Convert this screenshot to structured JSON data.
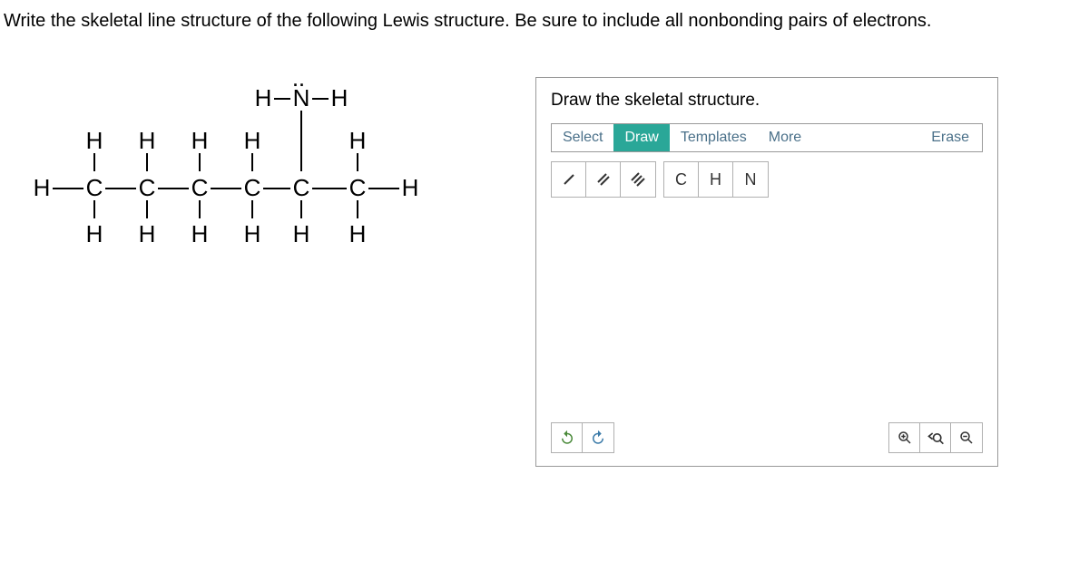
{
  "question": "Write the skeletal line structure of the following Lewis structure. Be sure to include all nonbonding pairs of electrons.",
  "draw_panel": {
    "title": "Draw the skeletal structure.",
    "tabs": {
      "select": "Select",
      "draw": "Draw",
      "templates": "Templates",
      "more": "More",
      "erase": "Erase"
    },
    "bonds": {
      "single": "/",
      "double": "//",
      "triple": "///"
    },
    "elements": {
      "c": "C",
      "h": "H",
      "n": "N"
    }
  },
  "atoms": {
    "H": "H",
    "C": "C",
    "N": "N"
  }
}
